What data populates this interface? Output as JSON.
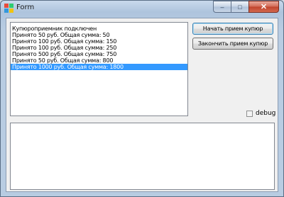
{
  "window": {
    "title": "Form",
    "icon": "app-icon",
    "caption": {
      "minimize": "‒",
      "maximize": "□",
      "close": "✕"
    }
  },
  "listbox": {
    "items": [
      "Купюроприемник подключен",
      "Принято 50 руб. Общая сумма: 50",
      "Принято 100 руб. Общая сумма: 150",
      "Принято 100 руб. Общая сумма: 250",
      "Принято 500 руб. Общая сумма: 750",
      "Принято 50 руб. Общая сумма: 800",
      "Принято 1000 руб. Общая сумма: 1800"
    ],
    "selected_index": 6
  },
  "buttons": {
    "start_label": "Начать прием купюр",
    "stop_label": "Закончить прием купюр"
  },
  "debug": {
    "label": "debug",
    "checked": false
  },
  "log": {
    "text": ""
  },
  "colors": {
    "selection": "#3399ff",
    "close_button": "#c0432c"
  }
}
